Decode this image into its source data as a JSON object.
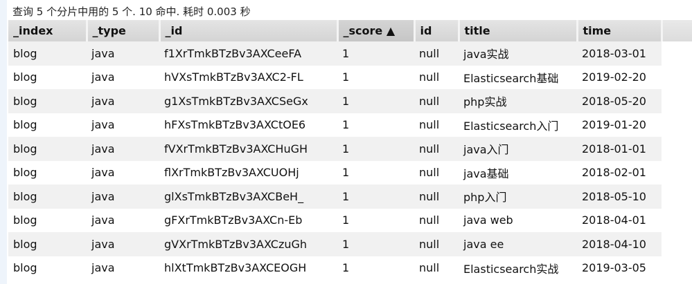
{
  "summary": "查询 5 个分片中用的 5 个. 10 命中. 耗时 0.003 秒",
  "columns": [
    "_index",
    "_type",
    "_id",
    "_score ▲",
    "id",
    "title",
    "time"
  ],
  "rows": [
    [
      "blog",
      "java",
      "f1XrTmkBTzBv3AXCeeFA",
      "1",
      "null",
      "java实战",
      "2018-03-01"
    ],
    [
      "blog",
      "java",
      "hVXsTmkBTzBv3AXC2-FL",
      "1",
      "null",
      "Elasticsearch基础",
      "2019-02-20"
    ],
    [
      "blog",
      "java",
      "g1XsTmkBTzBv3AXCSeGx",
      "1",
      "null",
      "php实战",
      "2018-05-20"
    ],
    [
      "blog",
      "java",
      "hFXsTmkBTzBv3AXCtOE6",
      "1",
      "null",
      "Elasticsearch入门",
      "2019-01-20"
    ],
    [
      "blog",
      "java",
      "fVXrTmkBTzBv3AXCHuGH",
      "1",
      "null",
      "java入门",
      "2018-01-01"
    ],
    [
      "blog",
      "java",
      "flXrTmkBTzBv3AXCUOHj",
      "1",
      "null",
      "java基础",
      "2018-02-01"
    ],
    [
      "blog",
      "java",
      "glXsTmkBTzBv3AXCBeH_",
      "1",
      "null",
      "php入门",
      "2018-05-10"
    ],
    [
      "blog",
      "java",
      "gFXrTmkBTzBv3AXCn-Eb",
      "1",
      "null",
      "java web",
      "2018-04-01"
    ],
    [
      "blog",
      "java",
      "gVXrTmkBTzBv3AXCzuGh",
      "1",
      "null",
      "java ee",
      "2018-04-10"
    ],
    [
      "blog",
      "java",
      "hlXtTmkBTzBv3AXCEOGH",
      "1",
      "null",
      "Elasticsearch实战",
      "2019-03-05"
    ]
  ]
}
